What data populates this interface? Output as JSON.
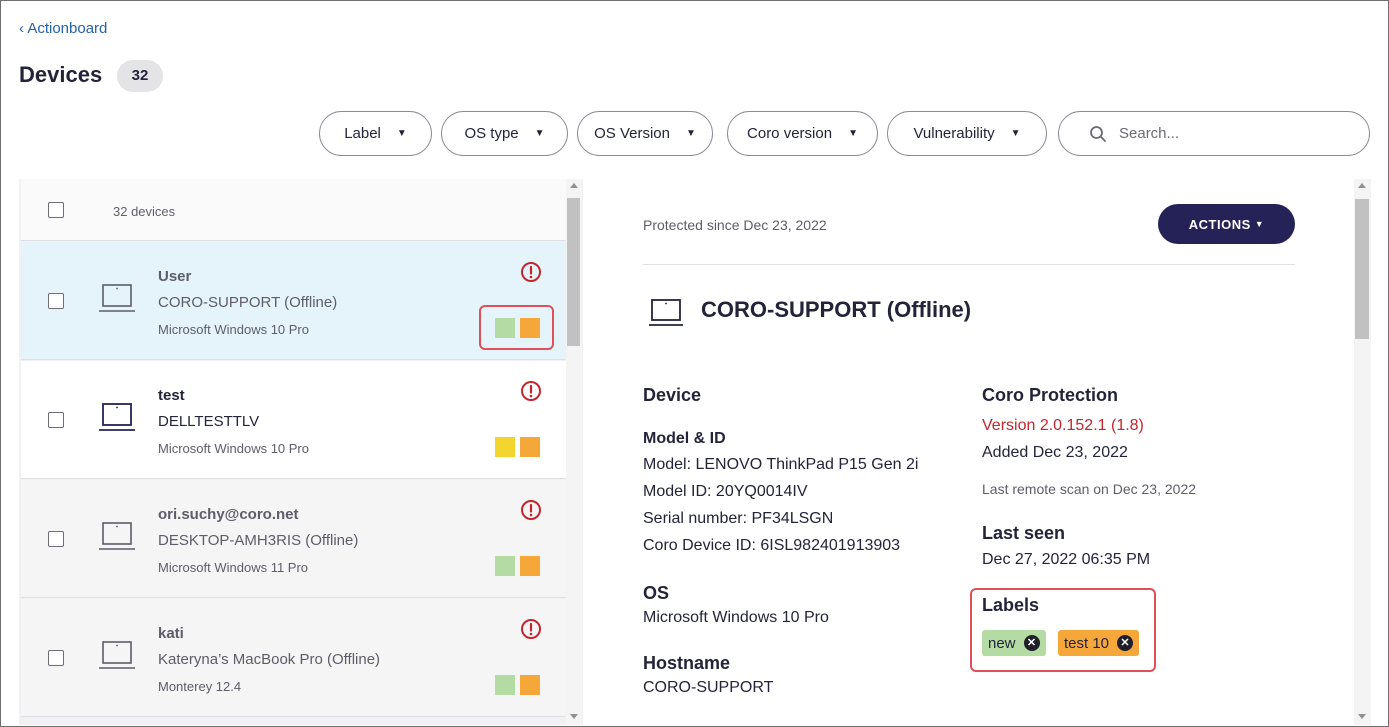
{
  "header": {
    "back_link": "‹ Actionboard",
    "title": "Devices",
    "count": "32"
  },
  "filters": [
    {
      "label": "Label"
    },
    {
      "label": "OS type"
    },
    {
      "label": "OS Version"
    },
    {
      "label": "Coro version"
    },
    {
      "label": "Vulnerability"
    }
  ],
  "search": {
    "placeholder": "Search..."
  },
  "list": {
    "count_label": "32 devices",
    "items": [
      {
        "name": "User",
        "hostname": "CORO-SUPPORT (Offline)",
        "os": "Microsoft Windows 10 Pro",
        "label_colors": [
          "#b4dba3",
          "#f5a73a"
        ]
      },
      {
        "name": "test",
        "hostname": "DELLTESTTLV",
        "os": "Microsoft Windows 10 Pro",
        "label_colors": [
          "#f2d62f",
          "#f5a73a"
        ]
      },
      {
        "name": "ori.suchy@coro.net",
        "hostname": "DESKTOP-AMH3RIS (Offline)",
        "os": "Microsoft Windows 11 Pro",
        "label_colors": [
          "#b4dba3",
          "#f5a73a"
        ]
      },
      {
        "name": "kati",
        "hostname": "Kateryna’s MacBook Pro (Offline)",
        "os": "Monterey 12.4",
        "label_colors": [
          "#b4dba3",
          "#f5a73a"
        ]
      }
    ]
  },
  "detail": {
    "protected_since": "Protected since Dec 23, 2022",
    "actions_label": "ACTIONS",
    "device_title": "CORO-SUPPORT (Offline)",
    "device_heading": "Device",
    "model_heading": "Model & ID",
    "model": "Model: LENOVO ThinkPad P15 Gen 2i",
    "model_id": "Model ID: 20YQ0014IV",
    "serial": "Serial number: PF34LSGN",
    "coro_device_id": "Coro Device ID: 6ISL982401913903",
    "os_heading": "OS",
    "os_value": "Microsoft Windows 10 Pro",
    "hostname_heading": "Hostname",
    "hostname_value": "CORO-SUPPORT",
    "protection_heading": "Coro Protection",
    "version": "Version 2.0.152.1 (1.8)",
    "added": "Added Dec 23, 2022",
    "last_scan": "Last remote scan on Dec 23, 2022",
    "last_seen_heading": "Last seen",
    "last_seen_value": "Dec 27, 2022 06:35 PM",
    "labels_heading": "Labels",
    "labels": [
      {
        "text": "new",
        "color": "#b4dba3"
      },
      {
        "text": "test 10",
        "color": "#f5a73a"
      }
    ]
  },
  "colors": {
    "accent": "#242257",
    "link": "#2462a8",
    "alert": "#c4262e",
    "selected_row": "#e5f4fb",
    "highlight_box": "#e0505a"
  }
}
